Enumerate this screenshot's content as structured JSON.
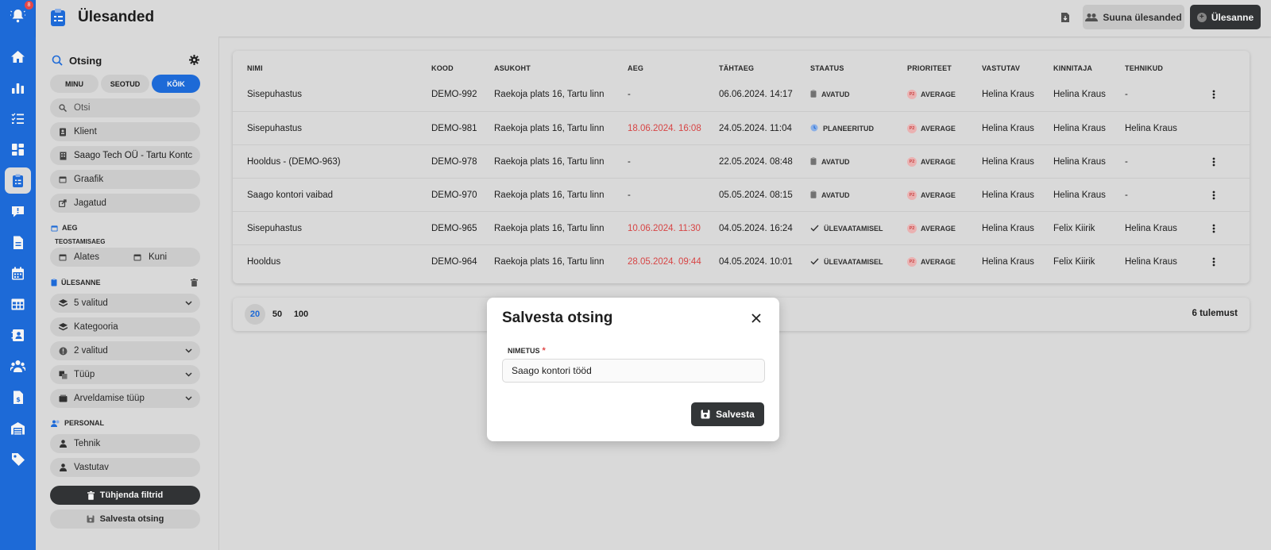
{
  "header": {
    "title": "Ülesanded",
    "suuna_label": "Suuna ülesanded",
    "new_task_label": "Ülesanne"
  },
  "rail": {
    "notification_count": "8",
    "items": [
      "bell-icon",
      "home-icon",
      "chart-icon",
      "checklist-icon",
      "dashboard-icon",
      "clipboard-icon",
      "chat-alert-icon",
      "document-icon",
      "calendar-icon",
      "table-icon",
      "contact-icon",
      "people-icon",
      "invoice-icon",
      "warehouse-icon",
      "tag-icon"
    ],
    "active_item": "clipboard-icon",
    "accent": "#1f6fe0"
  },
  "filters": {
    "title": "Otsing",
    "segments": [
      "MINU",
      "SEOTUD",
      "KÕIK"
    ],
    "active_segment": "KÕIK",
    "search_placeholder": "Otsi",
    "client": "Klient",
    "location": "Saago Tech OÜ - Tartu Kontc",
    "schedule": "Graafik",
    "shared": "Jagatud",
    "section_time": "AEG",
    "subsection_exec": "TEOSTAMISAEG",
    "from": "Alates",
    "to": "Kuni",
    "section_task": "ÜLESANNE",
    "selected_5": "5 valitud",
    "category": "Kategooria",
    "selected_2": "2 valitud",
    "type": "Tüüp",
    "billing_type": "Arveldamise tüüp",
    "section_staff": "PERSONAL",
    "technician": "Tehnik",
    "responsible": "Vastutav",
    "clear_label": "Tühjenda filtrid",
    "save_search_label": "Salvesta otsing"
  },
  "table": {
    "columns": [
      "NIMI",
      "KOOD",
      "ASUKOHT",
      "AEG",
      "TÄHTAEG",
      "STAATUS",
      "PRIORITEET",
      "VASTUTAV",
      "KINNITAJA",
      "TEHNIKUD"
    ],
    "rows": [
      {
        "name": "Sisepuhastus",
        "code": "DEMO-992",
        "location": "Raekoja plats 16, Tartu linn",
        "time": "-",
        "time_overdue": false,
        "deadline": "06.06.2024. 14:17",
        "status": "AVATUD",
        "status_icon": "clipboard-icon",
        "priority": "AVERAGE",
        "priority_badge": "P2",
        "responsible": "Helina Kraus",
        "approver": "Helina Kraus",
        "technicians": "-",
        "has_menu": true
      },
      {
        "name": "Sisepuhastus",
        "code": "DEMO-981",
        "location": "Raekoja plats 16, Tartu linn",
        "time": "18.06.2024. 16:08",
        "time_overdue": true,
        "deadline": "24.05.2024. 11:04",
        "status": "PLANEERITUD",
        "status_icon": "clock-icon",
        "priority": "AVERAGE",
        "priority_badge": "P2",
        "responsible": "Helina Kraus",
        "approver": "Helina Kraus",
        "technicians": "Helina Kraus",
        "has_menu": false
      },
      {
        "name": "Hooldus - (DEMO-963)",
        "code": "DEMO-978",
        "location": "Raekoja plats 16, Tartu linn",
        "time": "-",
        "time_overdue": false,
        "deadline": "22.05.2024. 08:48",
        "status": "AVATUD",
        "status_icon": "clipboard-icon",
        "priority": "AVERAGE",
        "priority_badge": "P2",
        "responsible": "Helina Kraus",
        "approver": "Helina Kraus",
        "technicians": "-",
        "has_menu": true
      },
      {
        "name": "Saago kontori vaibad",
        "code": "DEMO-970",
        "location": "Raekoja plats 16, Tartu linn",
        "time": "-",
        "time_overdue": false,
        "deadline": "05.05.2024. 08:15",
        "status": "AVATUD",
        "status_icon": "clipboard-icon",
        "priority": "AVERAGE",
        "priority_badge": "P2",
        "responsible": "Helina Kraus",
        "approver": "Helina Kraus",
        "technicians": "-",
        "has_menu": true
      },
      {
        "name": "Sisepuhastus",
        "code": "DEMO-965",
        "location": "Raekoja plats 16, Tartu linn",
        "time": "10.06.2024. 11:30",
        "time_overdue": true,
        "deadline": "04.05.2024. 16:24",
        "status": "ÜLEVAATAMISEL",
        "status_icon": "check-icon",
        "priority": "AVERAGE",
        "priority_badge": "P2",
        "responsible": "Helina Kraus",
        "approver": "Felix Kiirik",
        "technicians": "Helina Kraus",
        "has_menu": true
      },
      {
        "name": "Hooldus",
        "code": "DEMO-964",
        "location": "Raekoja plats 16, Tartu linn",
        "time": "28.05.2024. 09:44",
        "time_overdue": true,
        "deadline": "04.05.2024. 10:01",
        "status": "ÜLEVAATAMISEL",
        "status_icon": "check-icon",
        "priority": "AVERAGE",
        "priority_badge": "P2",
        "responsible": "Helina Kraus",
        "approver": "Felix Kiirik",
        "technicians": "Helina Kraus",
        "has_menu": true
      }
    ],
    "overdue_color": "#e04848"
  },
  "pagination": {
    "sizes": [
      "20",
      "50",
      "100"
    ],
    "active_size": "20",
    "results": "6 tulemust"
  },
  "modal": {
    "title": "Salvesta otsing",
    "field_label": "NIMETUS",
    "required_mark": "*",
    "field_value": "Saago kontori tööd",
    "save_label": "Salvesta"
  }
}
